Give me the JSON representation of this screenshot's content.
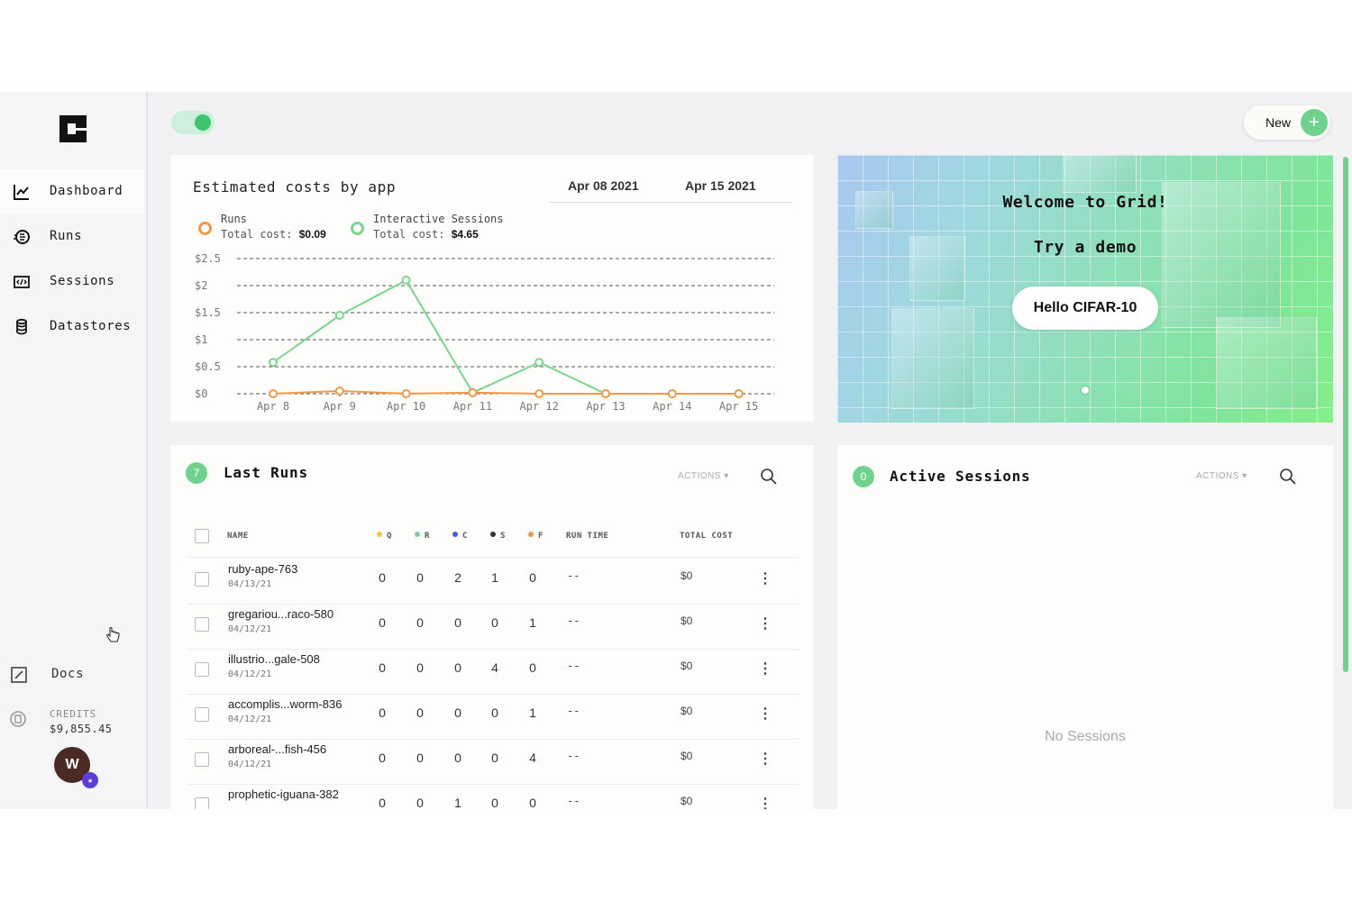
{
  "sidebar": {
    "items": [
      {
        "label": "Dashboard",
        "icon": "chart-line-icon"
      },
      {
        "label": "Runs",
        "icon": "runs-icon"
      },
      {
        "label": "Sessions",
        "icon": "code-window-icon"
      },
      {
        "label": "Datastores",
        "icon": "database-icon"
      }
    ],
    "docs_label": "Docs",
    "credits_label": "CREDITS",
    "credits_value": "$9,855.45",
    "avatar_initial": "W"
  },
  "header": {
    "new_label": "New",
    "new_icon": "+"
  },
  "costs": {
    "title": "Estimated costs by app",
    "date_start": "Apr 08 2021",
    "date_end": "Apr 15 2021",
    "legend": [
      {
        "name": "Runs",
        "cost_label": "Total cost:",
        "cost": "$0.09",
        "color": "#f0994a"
      },
      {
        "name": "Interactive Sessions",
        "cost_label": "Total cost:",
        "cost": "$4.65",
        "color": "#7dd391"
      }
    ]
  },
  "chart_data": {
    "type": "line",
    "categories": [
      "Apr 8",
      "Apr 9",
      "Apr 10",
      "Apr 11",
      "Apr 12",
      "Apr 13",
      "Apr 14",
      "Apr 15"
    ],
    "y_ticks": [
      "$0",
      "$0.5",
      "$1",
      "$1.5",
      "$2",
      "$2.5"
    ],
    "ylim": [
      0,
      2.5
    ],
    "grid": true,
    "series": [
      {
        "name": "Runs",
        "color": "#f0994a",
        "values": [
          0.0,
          0.05,
          0.0,
          0.02,
          0.0,
          0.0,
          0.0,
          0.0
        ]
      },
      {
        "name": "Interactive Sessions",
        "color": "#7dd391",
        "values": [
          0.58,
          1.45,
          2.1,
          0.02,
          0.58,
          0.0,
          0.0,
          0.0
        ]
      }
    ]
  },
  "welcome": {
    "title": "Welcome to Grid!",
    "subtitle": "Try a demo",
    "button": "Hello CIFAR-10"
  },
  "runs": {
    "count": "7",
    "title": "Last Runs",
    "actions": "ACTIONS",
    "columns": {
      "name": "NAME",
      "q": "Q",
      "r": "R",
      "c": "C",
      "s": "S",
      "f": "F",
      "run_time": "RUN TIME",
      "total_cost": "TOTAL COST"
    },
    "status_colors": {
      "q": "#f4c542",
      "r": "#7dd391",
      "c": "#4a5bd8",
      "s": "#333333",
      "f": "#f0994a"
    },
    "rows": [
      {
        "name": "ruby-ape-763",
        "date": "04/13/21",
        "q": "0",
        "r": "0",
        "c": "2",
        "s": "1",
        "f": "0",
        "run_time": "--",
        "cost": "$0"
      },
      {
        "name": "gregariou...raco-580",
        "date": "04/12/21",
        "q": "0",
        "r": "0",
        "c": "0",
        "s": "0",
        "f": "1",
        "run_time": "--",
        "cost": "$0"
      },
      {
        "name": "illustrio...gale-508",
        "date": "04/12/21",
        "q": "0",
        "r": "0",
        "c": "0",
        "s": "4",
        "f": "0",
        "run_time": "--",
        "cost": "$0"
      },
      {
        "name": "accomplis...worm-836",
        "date": "04/12/21",
        "q": "0",
        "r": "0",
        "c": "0",
        "s": "0",
        "f": "1",
        "run_time": "--",
        "cost": "$0"
      },
      {
        "name": "arboreal-...fish-456",
        "date": "04/12/21",
        "q": "0",
        "r": "0",
        "c": "0",
        "s": "0",
        "f": "4",
        "run_time": "--",
        "cost": "$0"
      },
      {
        "name": "prophetic-iguana-382",
        "date": "",
        "q": "0",
        "r": "0",
        "c": "1",
        "s": "0",
        "f": "0",
        "run_time": "--",
        "cost": "$0"
      }
    ]
  },
  "sessions": {
    "count": "0",
    "title": "Active Sessions",
    "actions": "ACTIONS",
    "empty": "No Sessions"
  }
}
